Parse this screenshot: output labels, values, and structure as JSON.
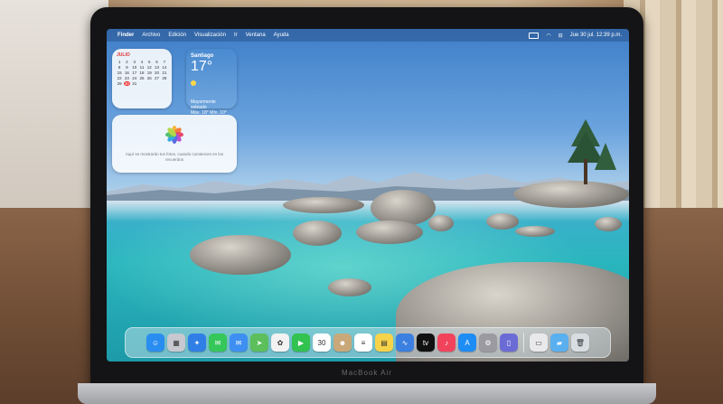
{
  "menubar": {
    "apple": "",
    "items": [
      "Finder",
      "Archivo",
      "Edición",
      "Visualización",
      "Ir",
      "Ventana",
      "Ayuda"
    ],
    "clock": "Jue 30 jul. 12:39 p.m."
  },
  "calendar_widget": {
    "month": "JULIO",
    "days": [
      "1",
      "2",
      "3",
      "4",
      "5",
      "6",
      "7",
      "8",
      "9",
      "10",
      "11",
      "12",
      "13",
      "14",
      "15",
      "16",
      "17",
      "18",
      "19",
      "20",
      "21",
      "22",
      "23",
      "24",
      "25",
      "26",
      "27",
      "28",
      "29",
      "30",
      "31"
    ],
    "today": "30"
  },
  "weather_widget": {
    "city": "Santiago",
    "temp": "17°",
    "condition": "Mayormente soleado",
    "range": "Máx. 18° Mín. 10°"
  },
  "photos_widget": {
    "message": "Aquí se mostrarán tus fotos, cuando comiences en los recuerdos"
  },
  "dock": {
    "apps": [
      {
        "name": "finder",
        "glyph": "☺",
        "color": "#2a8df0"
      },
      {
        "name": "launchpad",
        "glyph": "▦",
        "color": "#c8c8d0"
      },
      {
        "name": "safari",
        "glyph": "✦",
        "color": "#2f7fe6"
      },
      {
        "name": "messages",
        "glyph": "✉",
        "color": "#35c75a"
      },
      {
        "name": "mail",
        "glyph": "✉",
        "color": "#3d8ff2"
      },
      {
        "name": "maps",
        "glyph": "➤",
        "color": "#5cbf5c"
      },
      {
        "name": "photos",
        "glyph": "✿",
        "color": "#f2f2f2"
      },
      {
        "name": "facetime",
        "glyph": "▶",
        "color": "#31c24f"
      },
      {
        "name": "calendar",
        "glyph": "30",
        "color": "#ffffff"
      },
      {
        "name": "contacts",
        "glyph": "☻",
        "color": "#c9a87a"
      },
      {
        "name": "reminders",
        "glyph": "≡",
        "color": "#ffffff"
      },
      {
        "name": "notes",
        "glyph": "▤",
        "color": "#f7d34a"
      },
      {
        "name": "freeform",
        "glyph": "∿",
        "color": "#3b7fe0"
      },
      {
        "name": "appletv",
        "glyph": "tv",
        "color": "#111111"
      },
      {
        "name": "music",
        "glyph": "♪",
        "color": "#f2435c"
      },
      {
        "name": "appstore",
        "glyph": "A",
        "color": "#1d8cf5"
      },
      {
        "name": "settings",
        "glyph": "⚙",
        "color": "#9a9aa0"
      },
      {
        "name": "iphone-mirroring",
        "glyph": "▯",
        "color": "#6b6bd6"
      }
    ],
    "trailing": [
      {
        "name": "preview",
        "glyph": "▭",
        "color": "#e9e9ec"
      },
      {
        "name": "downloads-folder",
        "glyph": "▰",
        "color": "#5ab0ef"
      },
      {
        "name": "trash",
        "glyph": "🗑",
        "color": "#d8dde2"
      }
    ]
  }
}
